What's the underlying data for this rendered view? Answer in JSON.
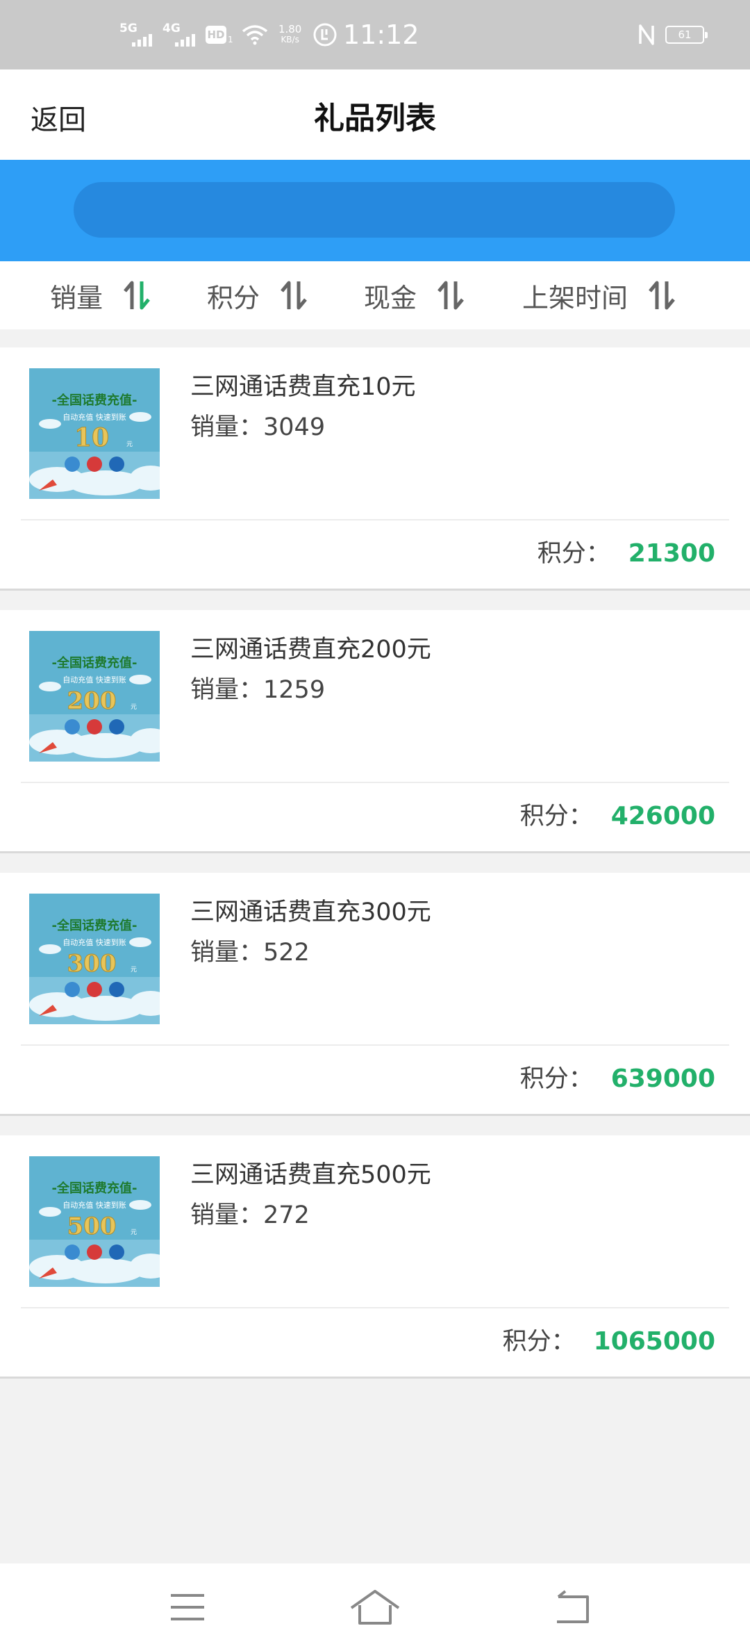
{
  "status_bar": {
    "network_1": "5G",
    "network_2": "4G",
    "hd_label": "HD",
    "hd_sub": "1",
    "speed_value": "1.80",
    "speed_unit": "KB/s",
    "time": "11:12",
    "battery": "61"
  },
  "header": {
    "back_label": "返回",
    "title": "礼品列表"
  },
  "search": {
    "value": "",
    "placeholder": ""
  },
  "sort_bar": {
    "items": [
      {
        "label": "销量",
        "active": true
      },
      {
        "label": "积分",
        "active": false
      },
      {
        "label": "现金",
        "active": false
      },
      {
        "label": "上架时间",
        "active": false
      }
    ]
  },
  "gift_list": {
    "sales_prefix": "销量：",
    "points_label": "积分：",
    "banner_title": "-全国话费充值-",
    "banner_subtitle": "自动充值 快速到账",
    "banner_unit": "元",
    "items": [
      {
        "name": "三网通话费直充10元",
        "amount": "10",
        "sales": "3049",
        "points": "21300"
      },
      {
        "name": "三网通话费直充200元",
        "amount": "200",
        "sales": "1259",
        "points": "426000"
      },
      {
        "name": "三网通话费直充300元",
        "amount": "300",
        "sales": "522",
        "points": "639000"
      },
      {
        "name": "三网通话费直充500元",
        "amount": "500",
        "sales": "272",
        "points": "1065000"
      }
    ]
  },
  "colors": {
    "accent_blue": "#2e9ef6",
    "search_fill": "#2689df",
    "points_green": "#22b06a",
    "sort_active_green": "#22b06a"
  },
  "icons": {
    "nav": [
      "menu-icon",
      "home-icon",
      "back-icon"
    ],
    "sort": "sort-arrows-icon"
  }
}
